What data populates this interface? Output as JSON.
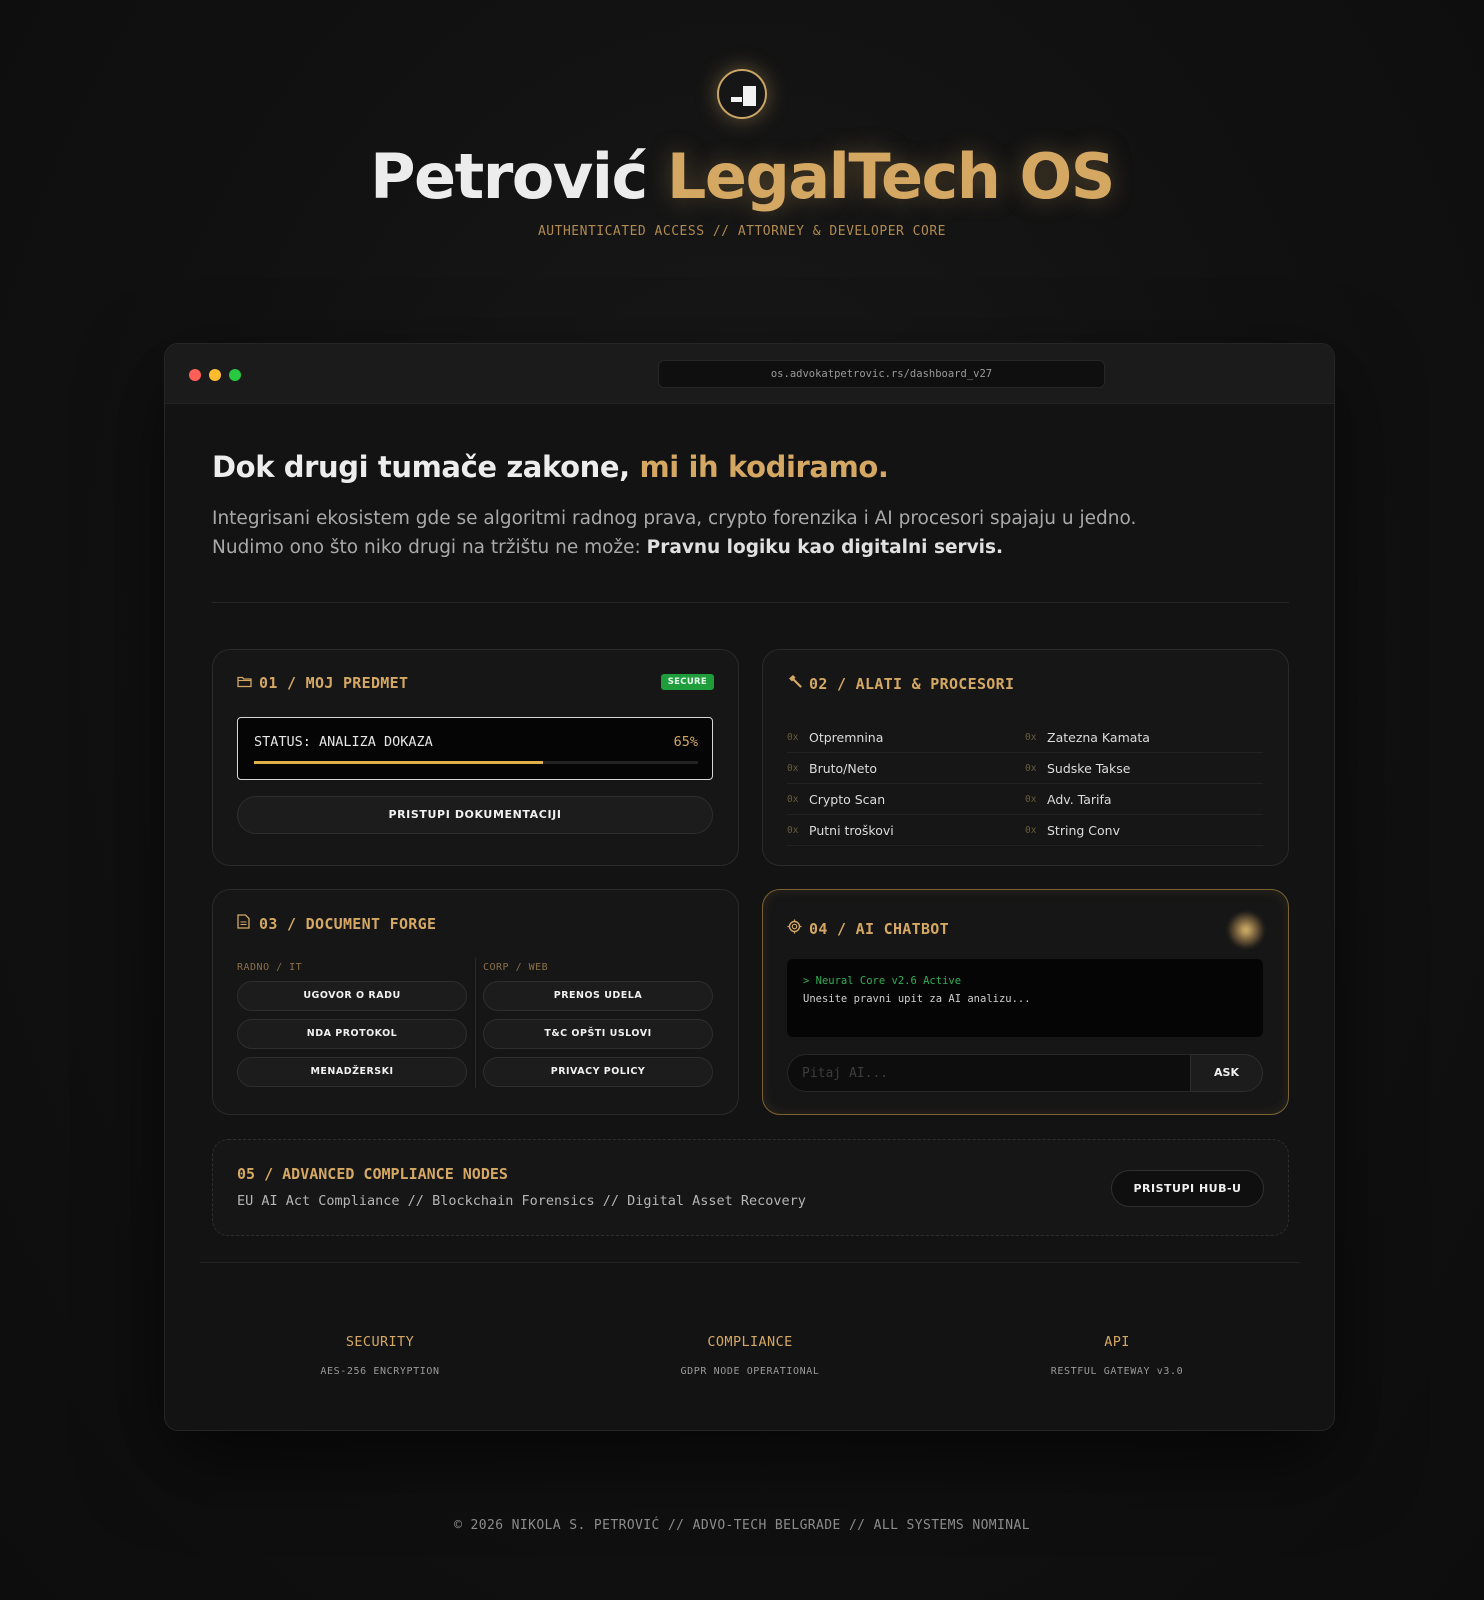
{
  "hero": {
    "title_main": "Petrović",
    "title_accent": "LegalTech OS",
    "subtitle": "AUTHENTICATED ACCESS // ATTORNEY & DEVELOPER CORE"
  },
  "browser": {
    "url": "os.advokatpetrovic.rs/dashboard_v27"
  },
  "intro": {
    "headline_main": "Dok drugi tumače zakone,",
    "headline_accent": "mi ih kodiramo.",
    "line1": "Integrisani ekosistem gde se algoritmi radnog prava, crypto forenzika i AI procesori spajaju u jedno.",
    "line2_prefix": "Nudimo ono što niko drugi na tržištu ne može:",
    "line2_strong": "Pravnu logiku kao digitalni servis."
  },
  "card1": {
    "icon": "folder-icon",
    "title": "01 / MOJ PREDMET",
    "badge": "SECURE",
    "status_label": "STATUS: ANALIZA DOKAZA",
    "progress_text": "65%",
    "progress_value": 0.65,
    "button": "PRISTUPI DOKUMENTACIJI"
  },
  "card2": {
    "icon": "hammer-icon",
    "title": "02 / ALATI & PROCESORI",
    "prefix": "0x",
    "tools": [
      [
        "Otpremnina",
        "Zatezna Kamata"
      ],
      [
        "Bruto/Neto",
        "Sudske Takse"
      ],
      [
        "Crypto Scan",
        "Adv. Tarifa"
      ],
      [
        "Putni troškovi",
        "String Conv"
      ]
    ]
  },
  "card3": {
    "icon": "document-icon",
    "title": "03 / DOCUMENT FORGE",
    "col1_label": "RADNO / IT",
    "col2_label": "CORP / WEB",
    "col1": [
      "UGOVOR O RADU",
      "NDA PROTOKOL",
      "MENADŽERSKI"
    ],
    "col2": [
      "PRENOS UDELA",
      "T&C OPŠTI USLOVI",
      "PRIVACY POLICY"
    ]
  },
  "card4": {
    "icon": "chip-icon",
    "title": "04 / AI CHATBOT",
    "terminal_line1": "> Neural Core v2.6 Active",
    "terminal_line2": "Unesite pravni upit za AI analizu...",
    "input_placeholder": "Pitaj AI...",
    "ask_button": "ASK"
  },
  "card5": {
    "title": "05 / ADVANCED COMPLIANCE NODES",
    "description": "EU AI Act Compliance // Blockchain Forensics // Digital Asset Recovery",
    "button": "PRISTUPI HUB-U"
  },
  "stats": [
    {
      "label": "SECURITY",
      "value": "AES-256 ENCRYPTION"
    },
    {
      "label": "COMPLIANCE",
      "value": "GDPR NODE OPERATIONAL"
    },
    {
      "label": "API",
      "value": "RESTFUL GATEWAY v3.0"
    }
  ],
  "footer": "© 2026 NIKOLA S. PETROVIĆ // ADVO-TECH BELGRADE // ALL SYSTEMS NOMINAL",
  "colors": {
    "accent": "#d4a862",
    "background": "#111111",
    "secure_badge": "#1f9d3b",
    "terminal_green": "#2fae56",
    "progress": "#e0b049"
  }
}
